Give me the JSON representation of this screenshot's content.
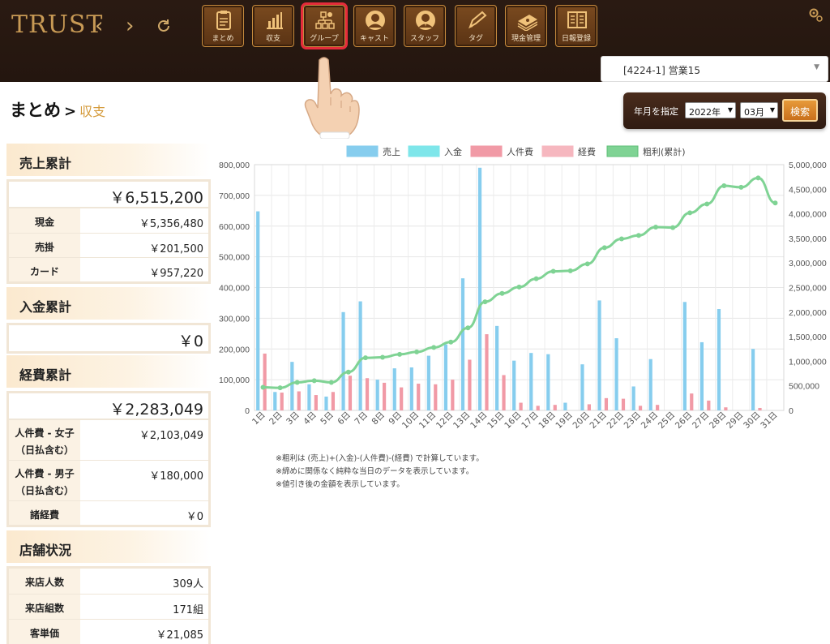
{
  "header": {
    "logo": "TRUST",
    "store_select": "[4224-1] 営業15",
    "nav": [
      {
        "label": "まとめ",
        "icon": "clipboard-icon"
      },
      {
        "label": "収支",
        "icon": "bar-chart-icon"
      },
      {
        "label": "グループ",
        "icon": "group-icon"
      },
      {
        "label": "キャスト",
        "icon": "person-icon"
      },
      {
        "label": "スタッフ",
        "icon": "staff-icon"
      },
      {
        "label": "タグ",
        "icon": "pencil-icon"
      },
      {
        "label": "現金管理",
        "icon": "money-icon"
      },
      {
        "label": "日報登録",
        "icon": "book-icon"
      }
    ]
  },
  "page": {
    "title": "まとめ",
    "arrow": ">",
    "subtitle": "収支"
  },
  "filter": {
    "label": "年月を指定",
    "year": "2022年",
    "month": "03月",
    "search": "検索"
  },
  "sales": {
    "heading": "売上累計",
    "total": "￥6,515,200",
    "rows": [
      {
        "k": "現金",
        "v": "￥5,356,480"
      },
      {
        "k": "売掛",
        "v": "￥201,500"
      },
      {
        "k": "カード",
        "v": "￥957,220"
      }
    ]
  },
  "deposit": {
    "heading": "入金累計",
    "total": "￥0"
  },
  "expense": {
    "heading": "経費累計",
    "total": "￥2,283,049",
    "rows": [
      {
        "k1": "人件費 - 女子",
        "k2": "（日払含む）",
        "v": "￥2,103,049"
      },
      {
        "k1": "人件費 - 男子",
        "k2": "（日払含む）",
        "v": "￥180,000"
      },
      {
        "k1": "諸経費",
        "k2": "",
        "v": "￥0"
      }
    ]
  },
  "store": {
    "heading": "店舗状況",
    "rows": [
      {
        "k": "来店人数",
        "v": "309人"
      },
      {
        "k": "来店組数",
        "v": "171組"
      },
      {
        "k": "客単価",
        "v": "￥21,085"
      }
    ]
  },
  "notes": [
    "※粗利は (売上)+(入金)-(人件費)-(経費) で計算しています。",
    "※締めに関係なく純粋な当日のデータを表示しています。",
    "※値引き後の金額を表示しています。"
  ],
  "colors": {
    "sales": "#86cdee",
    "deposit": "#7ee6ea",
    "labor": "#f19aa6",
    "expense": "#f6b7bf",
    "profit": "#7fd394"
  },
  "chart_data": {
    "type": "bar",
    "categories": [
      "1日",
      "2日",
      "3日",
      "4日",
      "5日",
      "6日",
      "7日",
      "8日",
      "9日",
      "10日",
      "11日",
      "12日",
      "13日",
      "14日",
      "15日",
      "16日",
      "17日",
      "18日",
      "19日",
      "20日",
      "21日",
      "22日",
      "23日",
      "24日",
      "25日",
      "26日",
      "27日",
      "28日",
      "29日",
      "30日",
      "31日"
    ],
    "legend": [
      "売上",
      "入金",
      "人件費",
      "経費",
      "粗利(累計)"
    ],
    "ylim_left": [
      0,
      800000
    ],
    "ylim_right": [
      0,
      5000000
    ],
    "yticks_left": [
      "0",
      "100,000",
      "200,000",
      "300,000",
      "400,000",
      "500,000",
      "600,000",
      "700,000",
      "800,000"
    ],
    "yticks_right": [
      "0",
      "500,000",
      "1,000,000",
      "1,500,000",
      "2,000,000",
      "2,500,000",
      "3,000,000",
      "3,500,000",
      "4,000,000",
      "4,500,000",
      "5,000,000"
    ],
    "series": [
      {
        "name": "売上",
        "axis": "left",
        "values": [
          648000,
          60000,
          158000,
          85000,
          45000,
          320000,
          355000,
          100000,
          137000,
          140000,
          178000,
          215000,
          430000,
          790000,
          275000,
          162000,
          187000,
          183000,
          25000,
          150000,
          358000,
          235000,
          78000,
          167000,
          0,
          353000,
          222000,
          330000,
          0,
          200000,
          0
        ]
      },
      {
        "name": "入金",
        "axis": "left",
        "values": [
          0,
          0,
          0,
          0,
          0,
          0,
          0,
          0,
          0,
          0,
          0,
          0,
          0,
          0,
          0,
          0,
          0,
          0,
          0,
          0,
          0,
          0,
          0,
          0,
          0,
          0,
          0,
          0,
          0,
          0,
          0
        ]
      },
      {
        "name": "人件費",
        "axis": "left",
        "values": [
          185000,
          58000,
          62000,
          50000,
          60000,
          113000,
          105000,
          90000,
          75000,
          87000,
          85000,
          100000,
          165000,
          248000,
          115000,
          25000,
          15000,
          18000,
          0,
          20000,
          40000,
          38000,
          15000,
          18000,
          0,
          55000,
          32000,
          10000,
          0,
          8000,
          0
        ]
      },
      {
        "name": "経費",
        "axis": "left",
        "values": [
          0,
          0,
          0,
          0,
          0,
          0,
          0,
          0,
          0,
          0,
          0,
          0,
          0,
          0,
          0,
          0,
          0,
          0,
          0,
          0,
          0,
          0,
          0,
          0,
          0,
          0,
          0,
          0,
          0,
          0,
          0
        ]
      },
      {
        "name": "粗利(累計)",
        "axis": "right",
        "type": "line",
        "values": [
          470000,
          460000,
          570000,
          605000,
          570000,
          780000,
          1070000,
          1080000,
          1140000,
          1190000,
          1280000,
          1390000,
          1680000,
          2210000,
          2380000,
          2510000,
          2680000,
          2830000,
          2840000,
          2980000,
          3310000,
          3490000,
          3560000,
          3730000,
          3720000,
          4020000,
          4200000,
          4570000,
          4540000,
          4730000,
          4220000
        ]
      }
    ]
  }
}
